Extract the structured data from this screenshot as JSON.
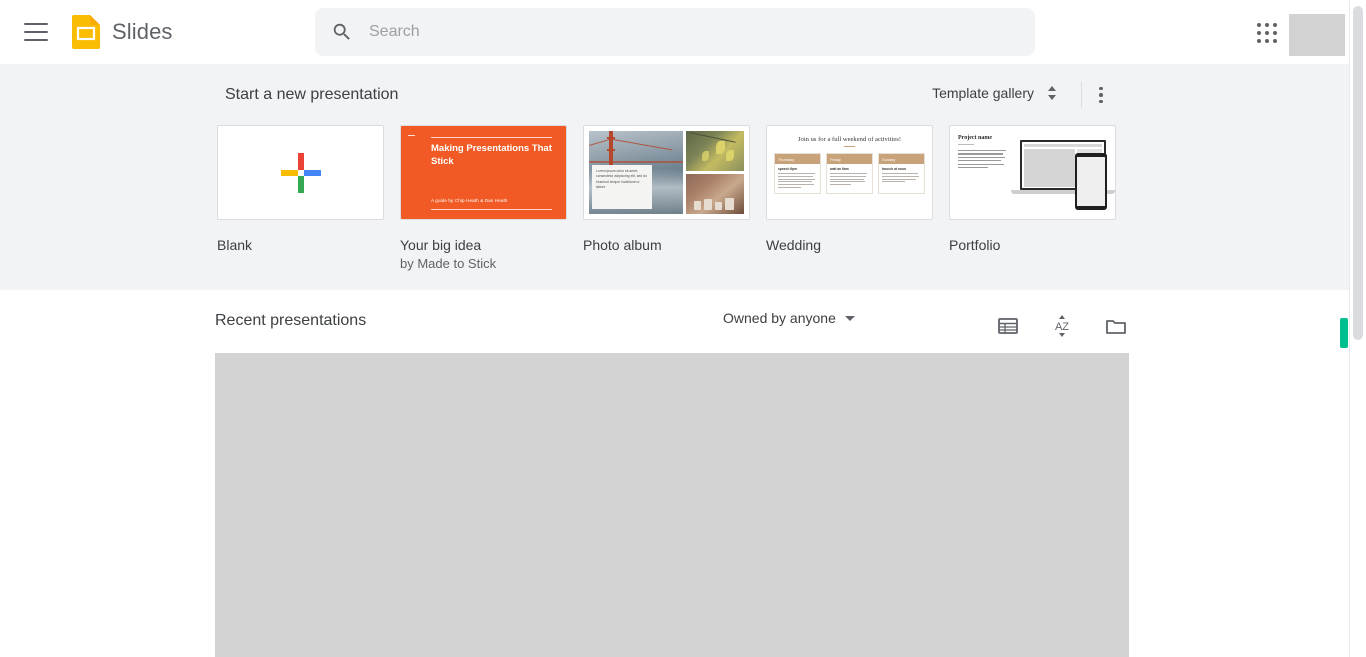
{
  "header": {
    "menu_icon": "hamburger-menu-icon",
    "logo_icon": "google-slides-logo-icon",
    "app_title": "Slides",
    "search": {
      "icon": "search-icon",
      "placeholder": "Search",
      "value": ""
    },
    "apps_icon": "apps-grid-icon",
    "avatar": "account-avatar"
  },
  "templates": {
    "section_title": "Start a new presentation",
    "gallery_toggle": {
      "label": "Template gallery",
      "icon": "expand-collapse-icon"
    },
    "more_icon": "more-options-icon",
    "items": [
      {
        "name": "Blank",
        "subtitle": "",
        "thumb": "blank-plus-thumbnail"
      },
      {
        "name": "Your big idea",
        "subtitle": "by Made to Stick",
        "thumb": "big-idea-thumbnail",
        "slide": {
          "title": "Making Presentations That Stick",
          "subtitle": "A guide by Chip Heath & Dan Heath",
          "accent_color": "#f15a24"
        }
      },
      {
        "name": "Photo album",
        "subtitle": "",
        "thumb": "photo-album-thumbnail",
        "slide": {
          "caption": "Lorem ipsum dolor sit amet, consectetur adipiscing elit, sed do eiusmod tempor incididunt ut labore"
        }
      },
      {
        "name": "Wedding",
        "subtitle": "",
        "thumb": "wedding-thumbnail",
        "slide": {
          "title": "Join us for a full weekend of activities!",
          "accent_color": "#c8a278",
          "columns": [
            {
              "day": "Thursday",
              "heading": "speech 6pm"
            },
            {
              "day": "Friday",
              "heading": "wait an 6am"
            },
            {
              "day": "Sunday",
              "heading": "brunch at noon"
            }
          ]
        }
      },
      {
        "name": "Portfolio",
        "subtitle": "",
        "thumb": "portfolio-thumbnail",
        "slide": {
          "title": "Project name"
        }
      }
    ]
  },
  "recent": {
    "title": "Recent presentations",
    "owner_filter": {
      "label": "Owned by anyone",
      "icon": "chevron-down-icon"
    },
    "view_icon": "list-view-icon",
    "sort_icon": "sort-az-icon",
    "folder_icon": "open-file-picker-icon"
  },
  "colors": {
    "brand_yellow": "#fbbc04",
    "section_background": "#f1f3f4",
    "placeholder_gray": "#d3d3d3",
    "marker_green": "#00bf8f"
  }
}
